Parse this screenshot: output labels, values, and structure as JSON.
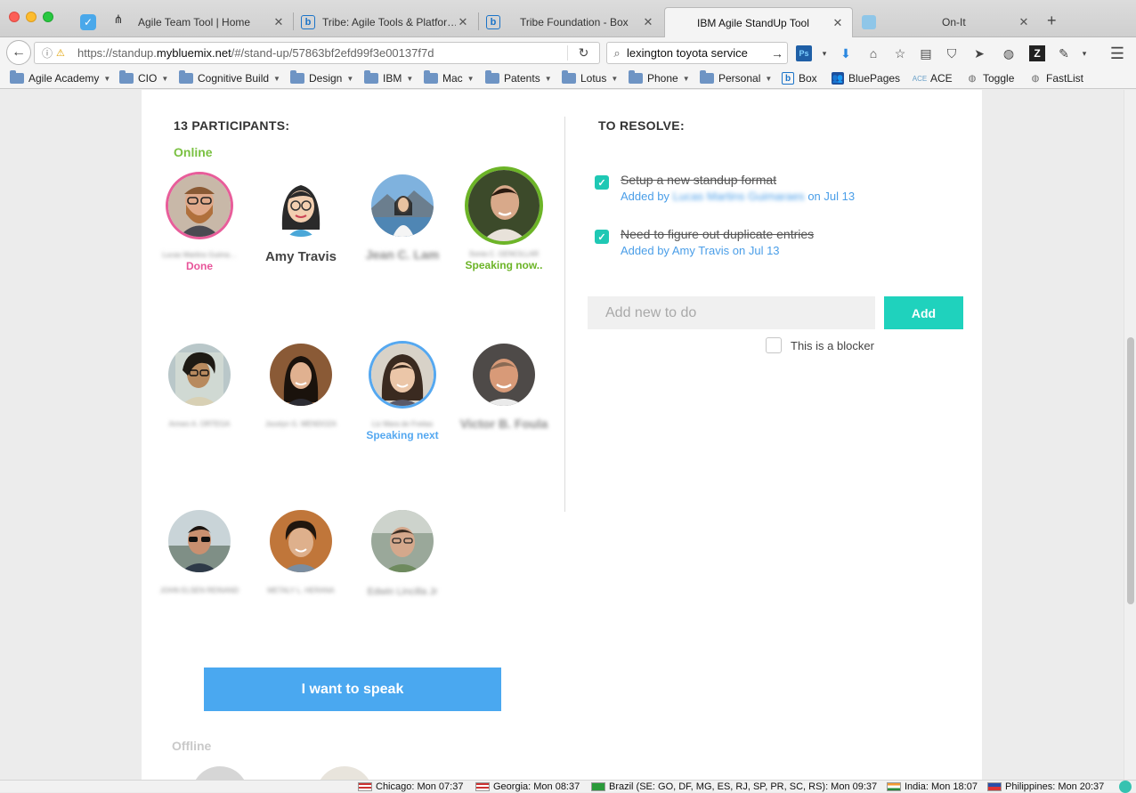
{
  "browser": {
    "tabs": [
      {
        "label": "Agile Team Tool | Home",
        "icon": "agile-team-tool-icon"
      },
      {
        "label": "Tribe: Agile Tools & Platfor…",
        "icon": "box-icon"
      },
      {
        "label": "Tribe Foundation - Box",
        "icon": "box-icon"
      },
      {
        "label": "IBM Agile StandUp Tool",
        "icon": "none",
        "active": true
      },
      {
        "label": "On-It",
        "icon": "onit-icon"
      }
    ],
    "url_prefix": "https://standup.",
    "url_domain": "mybluemix.net",
    "url_path": "/#/stand-up/57863bf2efd99f3e00137f7d",
    "search_value": "lexington toyota service",
    "bookmarks": [
      {
        "label": "Agile Academy",
        "type": "folder"
      },
      {
        "label": "CIO",
        "type": "folder"
      },
      {
        "label": "Cognitive Build",
        "type": "folder"
      },
      {
        "label": "Design",
        "type": "folder"
      },
      {
        "label": "IBM",
        "type": "folder"
      },
      {
        "label": "Mac",
        "type": "folder"
      },
      {
        "label": "Patents",
        "type": "folder"
      },
      {
        "label": "Lotus",
        "type": "folder"
      },
      {
        "label": "Phone",
        "type": "folder"
      },
      {
        "label": "Personal",
        "type": "folder"
      },
      {
        "label": "Box",
        "type": "link"
      },
      {
        "label": "BluePages",
        "type": "link"
      },
      {
        "label": "ACE",
        "type": "link"
      },
      {
        "label": "Toggle",
        "type": "link"
      },
      {
        "label": "FastList",
        "type": "link"
      }
    ]
  },
  "standup": {
    "participants_title": "13 PARTICIPANTS:",
    "online_label": "Online",
    "offline_label": "Offline",
    "speak_button": "I want to speak",
    "participants": [
      {
        "name": "Lucas Martins Guima…",
        "status": "Done"
      },
      {
        "name": "Amy Travis",
        "status": ""
      },
      {
        "name": "Jean C. Lam",
        "status": ""
      },
      {
        "name": "Sonia C. GENCILLAR",
        "status": "Speaking now.."
      },
      {
        "name": "Armen A. ORTEGA",
        "status": ""
      },
      {
        "name": "Jocelyn G. MENDOZA",
        "status": ""
      },
      {
        "name": "Liz Mara de Freitas",
        "status": "Speaking next"
      },
      {
        "name": "Victor B. Foula",
        "status": ""
      },
      {
        "name": "JOHN ELSEN REINAND",
        "status": ""
      },
      {
        "name": "METALY L. HERANA",
        "status": ""
      },
      {
        "name": "Edwin Lincilla Jr",
        "status": ""
      }
    ],
    "resolve_title": "TO RESOLVE:",
    "todos": [
      {
        "text": "Setup a new standup format",
        "added_by_prefix": "Added by",
        "added_by": "Lucas Martins Guimaraes",
        "date": "on Jul 13",
        "done": true
      },
      {
        "text": "Need to figure out duplicate entries",
        "added_by_prefix": "Added by",
        "added_by": "Amy Travis",
        "date": "on Jul 13",
        "done": true
      }
    ],
    "new_todo_placeholder": "Add new to do",
    "add_button": "Add",
    "blocker_label": "This is a blocker"
  },
  "statusbar": {
    "clocks": [
      {
        "label": "Chicago: Mon 07:37"
      },
      {
        "label": "Georgia: Mon 08:37"
      },
      {
        "label": "Brazil (SE: GO, DF, MG, ES, RJ, SP, PR, SC, RS): Mon 09:37"
      },
      {
        "label": "India: Mon 18:07"
      },
      {
        "label": "Philippines: Mon 20:37"
      }
    ]
  },
  "colors": {
    "done": "#e8559a",
    "speaking_now": "#6cb427",
    "speaking_next": "#55a8f0",
    "primary_button": "#4aa8f0",
    "add_button": "#1fd2bd",
    "online": "#7ac142"
  }
}
